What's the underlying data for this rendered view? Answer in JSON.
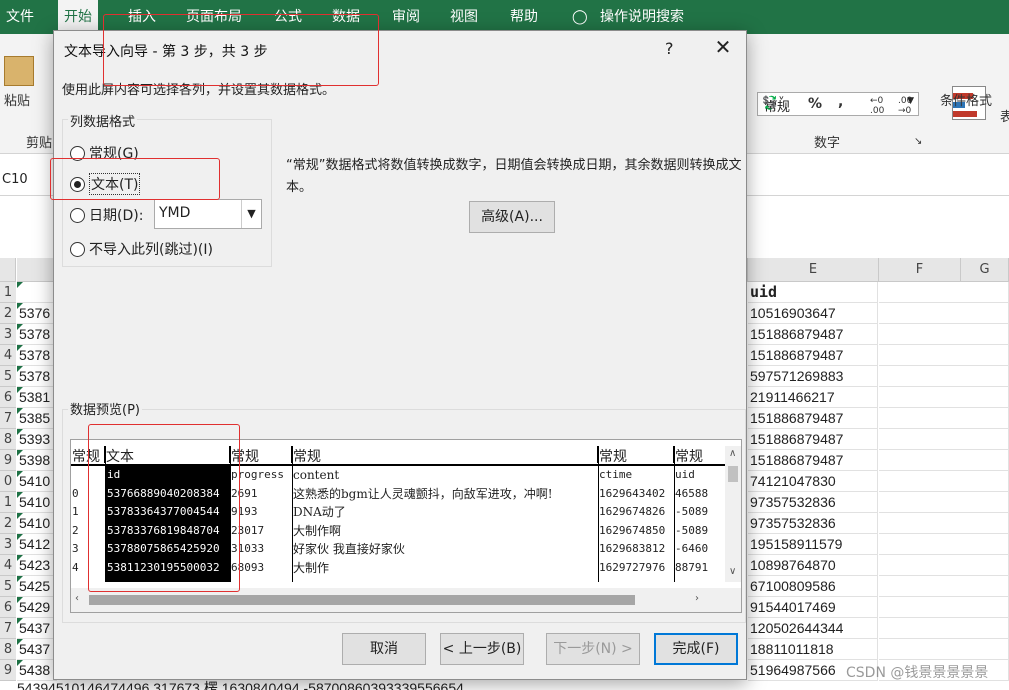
{
  "ribbon": {
    "tabs": [
      "文件",
      "开始",
      "插入",
      "页面布局",
      "公式",
      "数据",
      "审阅",
      "视图",
      "帮助",
      "操作说明搜索"
    ],
    "active_tab": "开始",
    "paste_label": "粘贴",
    "clipboard_label": "剪贴",
    "number_format_value": "常规",
    "percent_symbol": "%",
    "comma_symbol": ",",
    "dec_increase": "←0 .00",
    "dec_decrease": ".00 →0",
    "number_group_label": "数字",
    "conditional_format_label": "条件格式",
    "conditional_format_cut": "表",
    "namebox": "C10"
  },
  "grid": {
    "col_e_header": "E",
    "col_f_header": "F",
    "col_g_header": "G",
    "row_headers": [
      "1",
      "2",
      "3",
      "4",
      "5",
      "6",
      "7",
      "8",
      "9",
      "0",
      "1",
      "2",
      "3",
      "4",
      "5",
      "6",
      "7",
      "8",
      "9"
    ],
    "col_a_values": [
      "",
      "5376",
      "5378",
      "5378",
      "5378",
      "5381",
      "5385",
      "5393",
      "5398",
      "5410",
      "5410",
      "5410",
      "5412",
      "5423",
      "5425",
      "5429",
      "5437",
      "5437",
      "5438"
    ],
    "col_e_values": [
      "uid",
      "10516903647",
      "151886879487",
      "151886879487",
      "597571269883",
      "21911466217",
      "151886879487",
      "151886879487",
      "151886879487",
      "74121047830",
      "97357532836",
      "97357532836",
      "195158911579",
      "10898764870",
      "67100809586",
      "91544017469",
      "120502644344",
      "18811011818",
      "51964987566"
    ],
    "last_row_text": "54394510146474496        317673  楞                    1630840494  -58700860393339556654"
  },
  "dialog": {
    "title": "文本导入向导 - 第 3 步，共 3 步",
    "help": "?",
    "close": "✕",
    "intro": "使用此屏内容可选择各列，并设置其数据格式。",
    "group_label": "列数据格式",
    "radio_general": "常规(G)",
    "radio_text": "文本(T)",
    "radio_date": "日期(D):",
    "radio_skip": "不导入此列(跳过)(I)",
    "date_value": "YMD",
    "description": "“常规”数据格式将数值转换成数字，日期值会转换成日期，其余数据则转换成文本。",
    "advanced_button": "高级(A)...",
    "preview_label": "数据预览(P)",
    "cancel_button": "取消",
    "back_button": "< 上一步(B)",
    "next_button": "下一步(N) >",
    "finish_button": "完成(F)"
  },
  "preview": {
    "col_headers": [
      "常规",
      "文本",
      "常规",
      "常规",
      "常规",
      "常规"
    ],
    "index_col": [
      "",
      "0",
      "1",
      "2",
      "3",
      "4"
    ],
    "id_col": [
      "id",
      "53766889040208384",
      "53783364377004544",
      "53783376819848704",
      "53788075865425920",
      "53811230195500032"
    ],
    "progress_col": [
      "progress",
      "2691",
      "9193",
      "23017",
      "31033",
      "68093"
    ],
    "content_col": [
      "content",
      "这熟悉的bgm让人灵魂颤抖，向敌军进攻，冲啊!",
      "DNA动了",
      "大制作啊",
      "好家伙 我直接好家伙",
      "大制作"
    ],
    "ctime_col": [
      "ctime",
      "1629643402",
      "1629674826",
      "1629674850",
      "1629683812",
      "1629727976"
    ],
    "uid_col": [
      "uid",
      "46588",
      "-5089",
      "-5089",
      "-6460",
      "88791"
    ]
  },
  "watermark": "CSDN @钱景景景景景"
}
